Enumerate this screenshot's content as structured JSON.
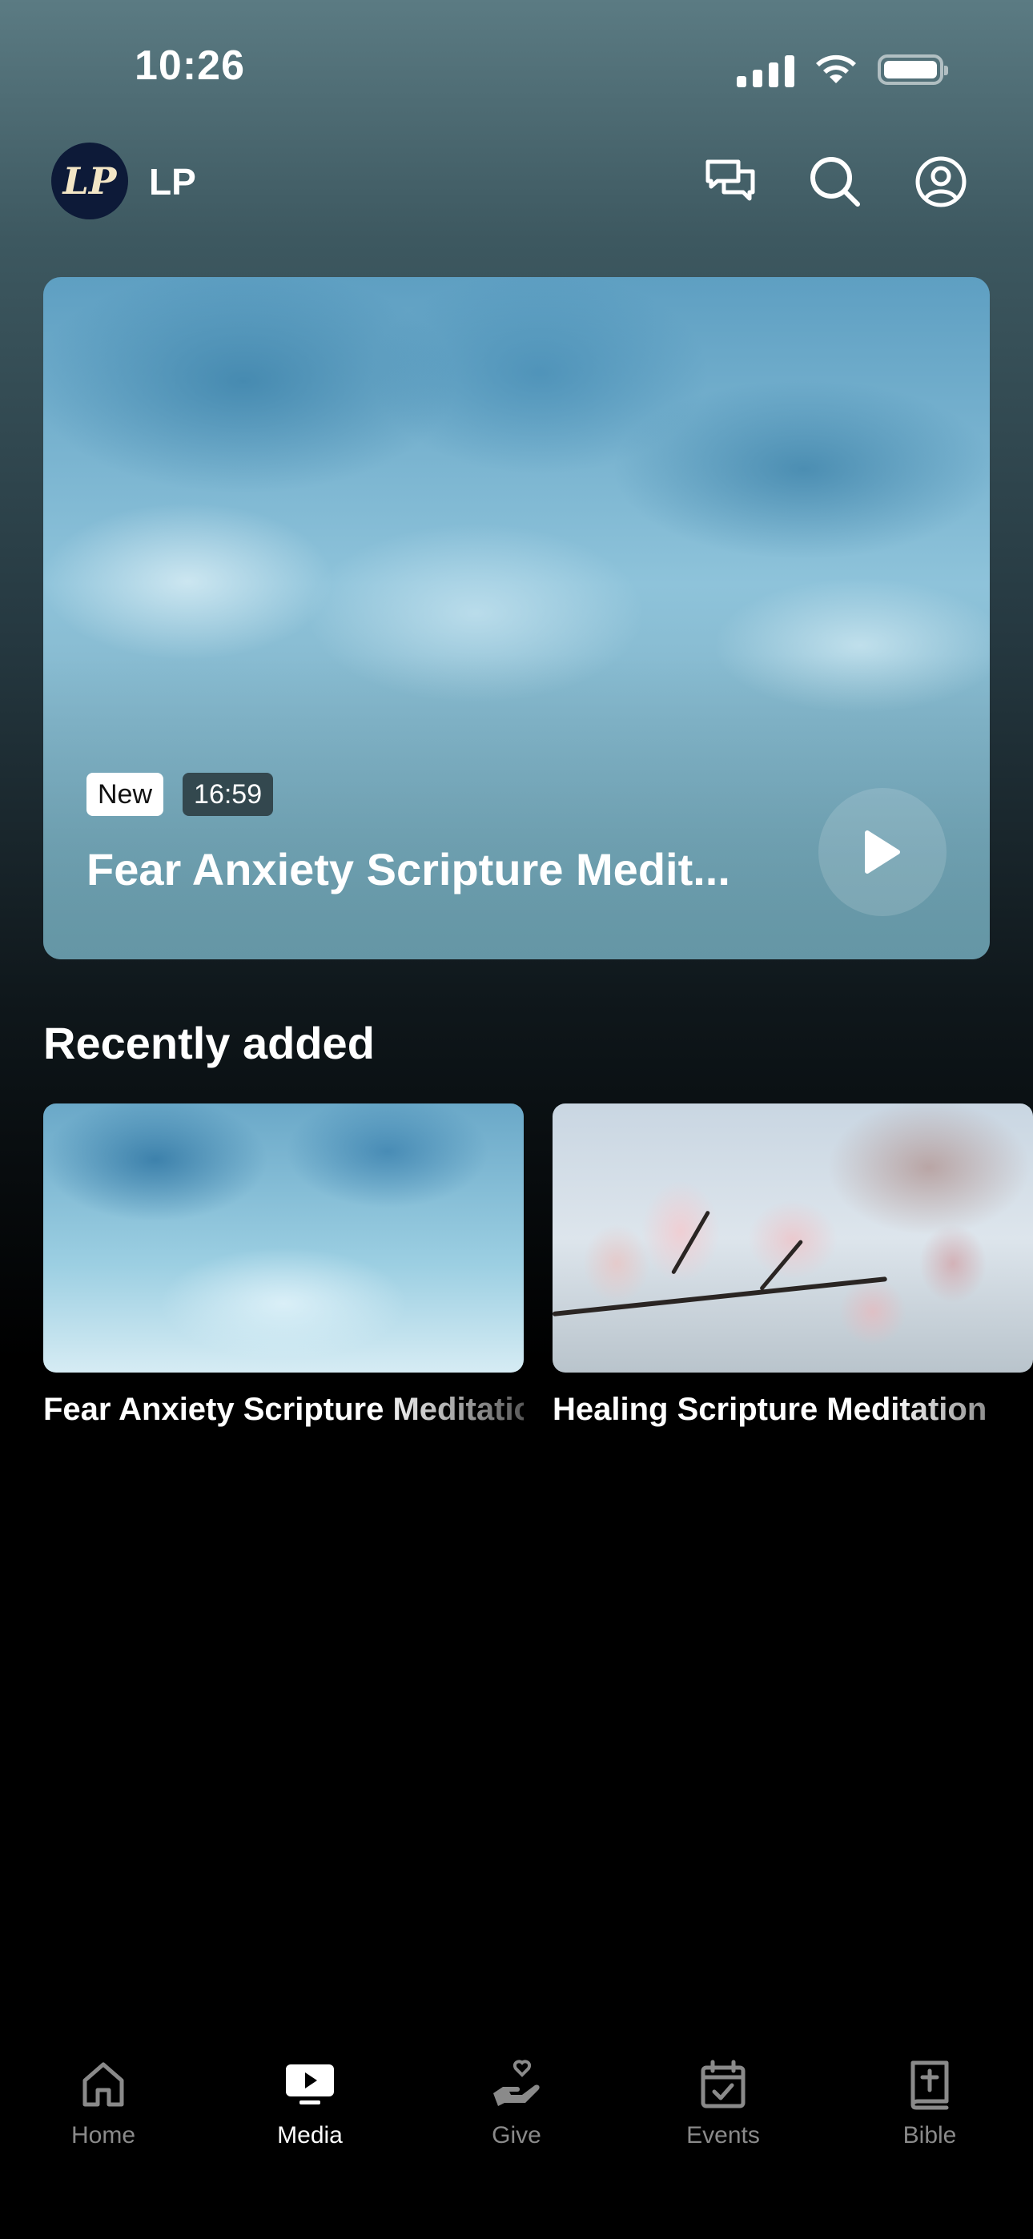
{
  "status_bar": {
    "time": "10:26"
  },
  "header": {
    "logo_text": "LP",
    "org_name": "LP"
  },
  "hero": {
    "badge_new": "New",
    "duration": "16:59",
    "title": "Fear Anxiety Scripture Medit..."
  },
  "recently_added": {
    "title": "Recently added",
    "items": [
      {
        "title": "Fear Anxiety Scripture Meditation"
      },
      {
        "title": "Healing Scripture Meditation"
      }
    ]
  },
  "tabs": [
    {
      "label": "Home",
      "icon": "home-icon",
      "active": false
    },
    {
      "label": "Media",
      "icon": "media-icon",
      "active": true
    },
    {
      "label": "Give",
      "icon": "give-icon",
      "active": false
    },
    {
      "label": "Events",
      "icon": "events-icon",
      "active": false
    },
    {
      "label": "Bible",
      "icon": "bible-icon",
      "active": false
    }
  ]
}
